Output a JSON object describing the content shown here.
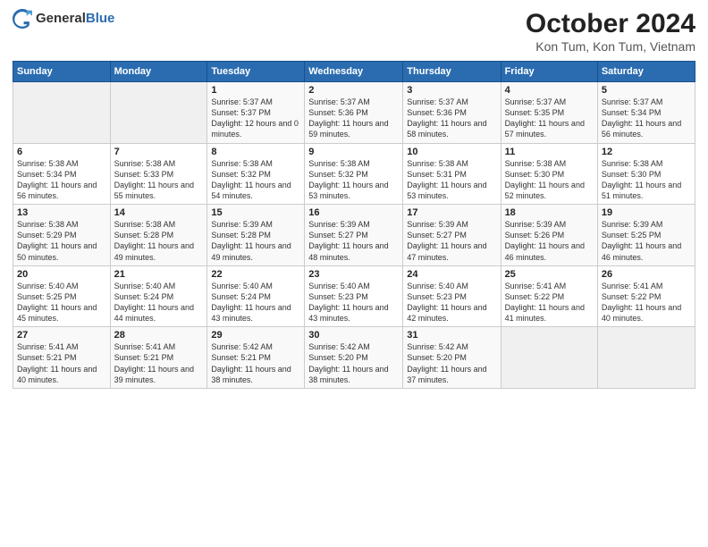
{
  "header": {
    "logo_general": "General",
    "logo_blue": "Blue",
    "title": "October 2024",
    "subtitle": "Kon Tum, Kon Tum, Vietnam"
  },
  "calendar": {
    "days_header": [
      "Sunday",
      "Monday",
      "Tuesday",
      "Wednesday",
      "Thursday",
      "Friday",
      "Saturday"
    ],
    "weeks": [
      [
        {
          "day": "",
          "sunrise": "",
          "sunset": "",
          "daylight": "",
          "empty": true
        },
        {
          "day": "",
          "sunrise": "",
          "sunset": "",
          "daylight": "",
          "empty": true
        },
        {
          "day": "1",
          "sunrise": "Sunrise: 5:37 AM",
          "sunset": "Sunset: 5:37 PM",
          "daylight": "Daylight: 12 hours and 0 minutes.",
          "empty": false
        },
        {
          "day": "2",
          "sunrise": "Sunrise: 5:37 AM",
          "sunset": "Sunset: 5:36 PM",
          "daylight": "Daylight: 11 hours and 59 minutes.",
          "empty": false
        },
        {
          "day": "3",
          "sunrise": "Sunrise: 5:37 AM",
          "sunset": "Sunset: 5:36 PM",
          "daylight": "Daylight: 11 hours and 58 minutes.",
          "empty": false
        },
        {
          "day": "4",
          "sunrise": "Sunrise: 5:37 AM",
          "sunset": "Sunset: 5:35 PM",
          "daylight": "Daylight: 11 hours and 57 minutes.",
          "empty": false
        },
        {
          "day": "5",
          "sunrise": "Sunrise: 5:37 AM",
          "sunset": "Sunset: 5:34 PM",
          "daylight": "Daylight: 11 hours and 56 minutes.",
          "empty": false
        }
      ],
      [
        {
          "day": "6",
          "sunrise": "Sunrise: 5:38 AM",
          "sunset": "Sunset: 5:34 PM",
          "daylight": "Daylight: 11 hours and 56 minutes.",
          "empty": false
        },
        {
          "day": "7",
          "sunrise": "Sunrise: 5:38 AM",
          "sunset": "Sunset: 5:33 PM",
          "daylight": "Daylight: 11 hours and 55 minutes.",
          "empty": false
        },
        {
          "day": "8",
          "sunrise": "Sunrise: 5:38 AM",
          "sunset": "Sunset: 5:32 PM",
          "daylight": "Daylight: 11 hours and 54 minutes.",
          "empty": false
        },
        {
          "day": "9",
          "sunrise": "Sunrise: 5:38 AM",
          "sunset": "Sunset: 5:32 PM",
          "daylight": "Daylight: 11 hours and 53 minutes.",
          "empty": false
        },
        {
          "day": "10",
          "sunrise": "Sunrise: 5:38 AM",
          "sunset": "Sunset: 5:31 PM",
          "daylight": "Daylight: 11 hours and 53 minutes.",
          "empty": false
        },
        {
          "day": "11",
          "sunrise": "Sunrise: 5:38 AM",
          "sunset": "Sunset: 5:30 PM",
          "daylight": "Daylight: 11 hours and 52 minutes.",
          "empty": false
        },
        {
          "day": "12",
          "sunrise": "Sunrise: 5:38 AM",
          "sunset": "Sunset: 5:30 PM",
          "daylight": "Daylight: 11 hours and 51 minutes.",
          "empty": false
        }
      ],
      [
        {
          "day": "13",
          "sunrise": "Sunrise: 5:38 AM",
          "sunset": "Sunset: 5:29 PM",
          "daylight": "Daylight: 11 hours and 50 minutes.",
          "empty": false
        },
        {
          "day": "14",
          "sunrise": "Sunrise: 5:38 AM",
          "sunset": "Sunset: 5:28 PM",
          "daylight": "Daylight: 11 hours and 49 minutes.",
          "empty": false
        },
        {
          "day": "15",
          "sunrise": "Sunrise: 5:39 AM",
          "sunset": "Sunset: 5:28 PM",
          "daylight": "Daylight: 11 hours and 49 minutes.",
          "empty": false
        },
        {
          "day": "16",
          "sunrise": "Sunrise: 5:39 AM",
          "sunset": "Sunset: 5:27 PM",
          "daylight": "Daylight: 11 hours and 48 minutes.",
          "empty": false
        },
        {
          "day": "17",
          "sunrise": "Sunrise: 5:39 AM",
          "sunset": "Sunset: 5:27 PM",
          "daylight": "Daylight: 11 hours and 47 minutes.",
          "empty": false
        },
        {
          "day": "18",
          "sunrise": "Sunrise: 5:39 AM",
          "sunset": "Sunset: 5:26 PM",
          "daylight": "Daylight: 11 hours and 46 minutes.",
          "empty": false
        },
        {
          "day": "19",
          "sunrise": "Sunrise: 5:39 AM",
          "sunset": "Sunset: 5:25 PM",
          "daylight": "Daylight: 11 hours and 46 minutes.",
          "empty": false
        }
      ],
      [
        {
          "day": "20",
          "sunrise": "Sunrise: 5:40 AM",
          "sunset": "Sunset: 5:25 PM",
          "daylight": "Daylight: 11 hours and 45 minutes.",
          "empty": false
        },
        {
          "day": "21",
          "sunrise": "Sunrise: 5:40 AM",
          "sunset": "Sunset: 5:24 PM",
          "daylight": "Daylight: 11 hours and 44 minutes.",
          "empty": false
        },
        {
          "day": "22",
          "sunrise": "Sunrise: 5:40 AM",
          "sunset": "Sunset: 5:24 PM",
          "daylight": "Daylight: 11 hours and 43 minutes.",
          "empty": false
        },
        {
          "day": "23",
          "sunrise": "Sunrise: 5:40 AM",
          "sunset": "Sunset: 5:23 PM",
          "daylight": "Daylight: 11 hours and 43 minutes.",
          "empty": false
        },
        {
          "day": "24",
          "sunrise": "Sunrise: 5:40 AM",
          "sunset": "Sunset: 5:23 PM",
          "daylight": "Daylight: 11 hours and 42 minutes.",
          "empty": false
        },
        {
          "day": "25",
          "sunrise": "Sunrise: 5:41 AM",
          "sunset": "Sunset: 5:22 PM",
          "daylight": "Daylight: 11 hours and 41 minutes.",
          "empty": false
        },
        {
          "day": "26",
          "sunrise": "Sunrise: 5:41 AM",
          "sunset": "Sunset: 5:22 PM",
          "daylight": "Daylight: 11 hours and 40 minutes.",
          "empty": false
        }
      ],
      [
        {
          "day": "27",
          "sunrise": "Sunrise: 5:41 AM",
          "sunset": "Sunset: 5:21 PM",
          "daylight": "Daylight: 11 hours and 40 minutes.",
          "empty": false
        },
        {
          "day": "28",
          "sunrise": "Sunrise: 5:41 AM",
          "sunset": "Sunset: 5:21 PM",
          "daylight": "Daylight: 11 hours and 39 minutes.",
          "empty": false
        },
        {
          "day": "29",
          "sunrise": "Sunrise: 5:42 AM",
          "sunset": "Sunset: 5:21 PM",
          "daylight": "Daylight: 11 hours and 38 minutes.",
          "empty": false
        },
        {
          "day": "30",
          "sunrise": "Sunrise: 5:42 AM",
          "sunset": "Sunset: 5:20 PM",
          "daylight": "Daylight: 11 hours and 38 minutes.",
          "empty": false
        },
        {
          "day": "31",
          "sunrise": "Sunrise: 5:42 AM",
          "sunset": "Sunset: 5:20 PM",
          "daylight": "Daylight: 11 hours and 37 minutes.",
          "empty": false
        },
        {
          "day": "",
          "sunrise": "",
          "sunset": "",
          "daylight": "",
          "empty": true
        },
        {
          "day": "",
          "sunrise": "",
          "sunset": "",
          "daylight": "",
          "empty": true
        }
      ]
    ]
  }
}
